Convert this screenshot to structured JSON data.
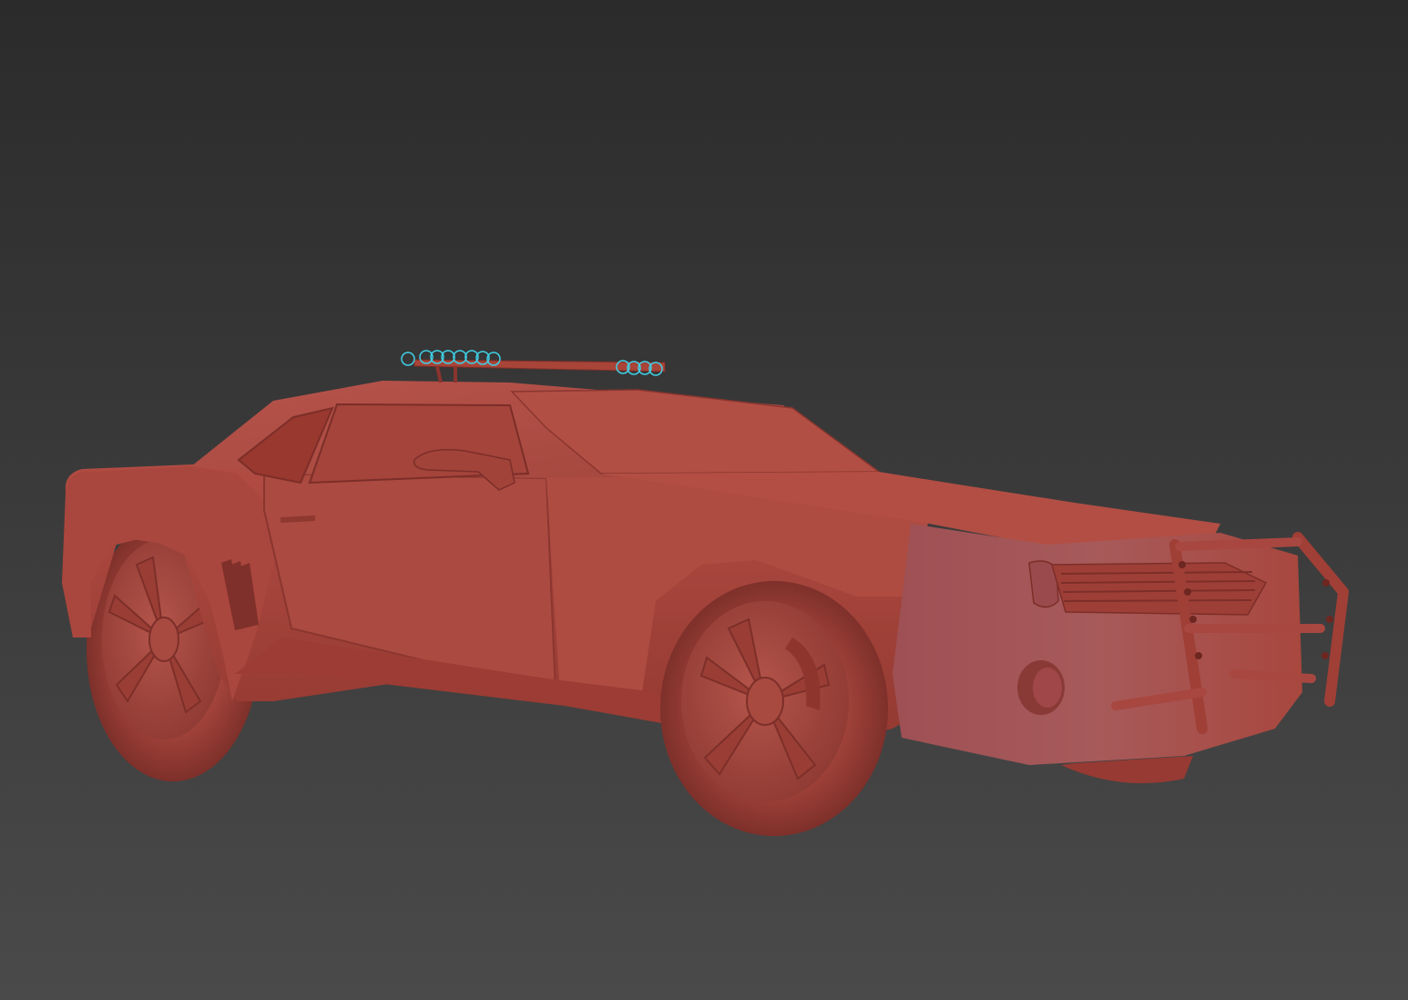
{
  "viewport": {
    "background": {
      "top_color": "#2b2b2b",
      "bottom_color": "#4a4a4a"
    },
    "model": {
      "object": "car",
      "shading": "clay",
      "body_color": "#b04a40",
      "shadow_color": "#7a2f28",
      "highlight_color": "#c86258",
      "light_helper_color": "#3fd0e6",
      "accessories": [
        "roof-light-bar",
        "push-bumper",
        "front-wheel",
        "rear-wheel",
        "side-mirror",
        "fog-light"
      ]
    }
  }
}
